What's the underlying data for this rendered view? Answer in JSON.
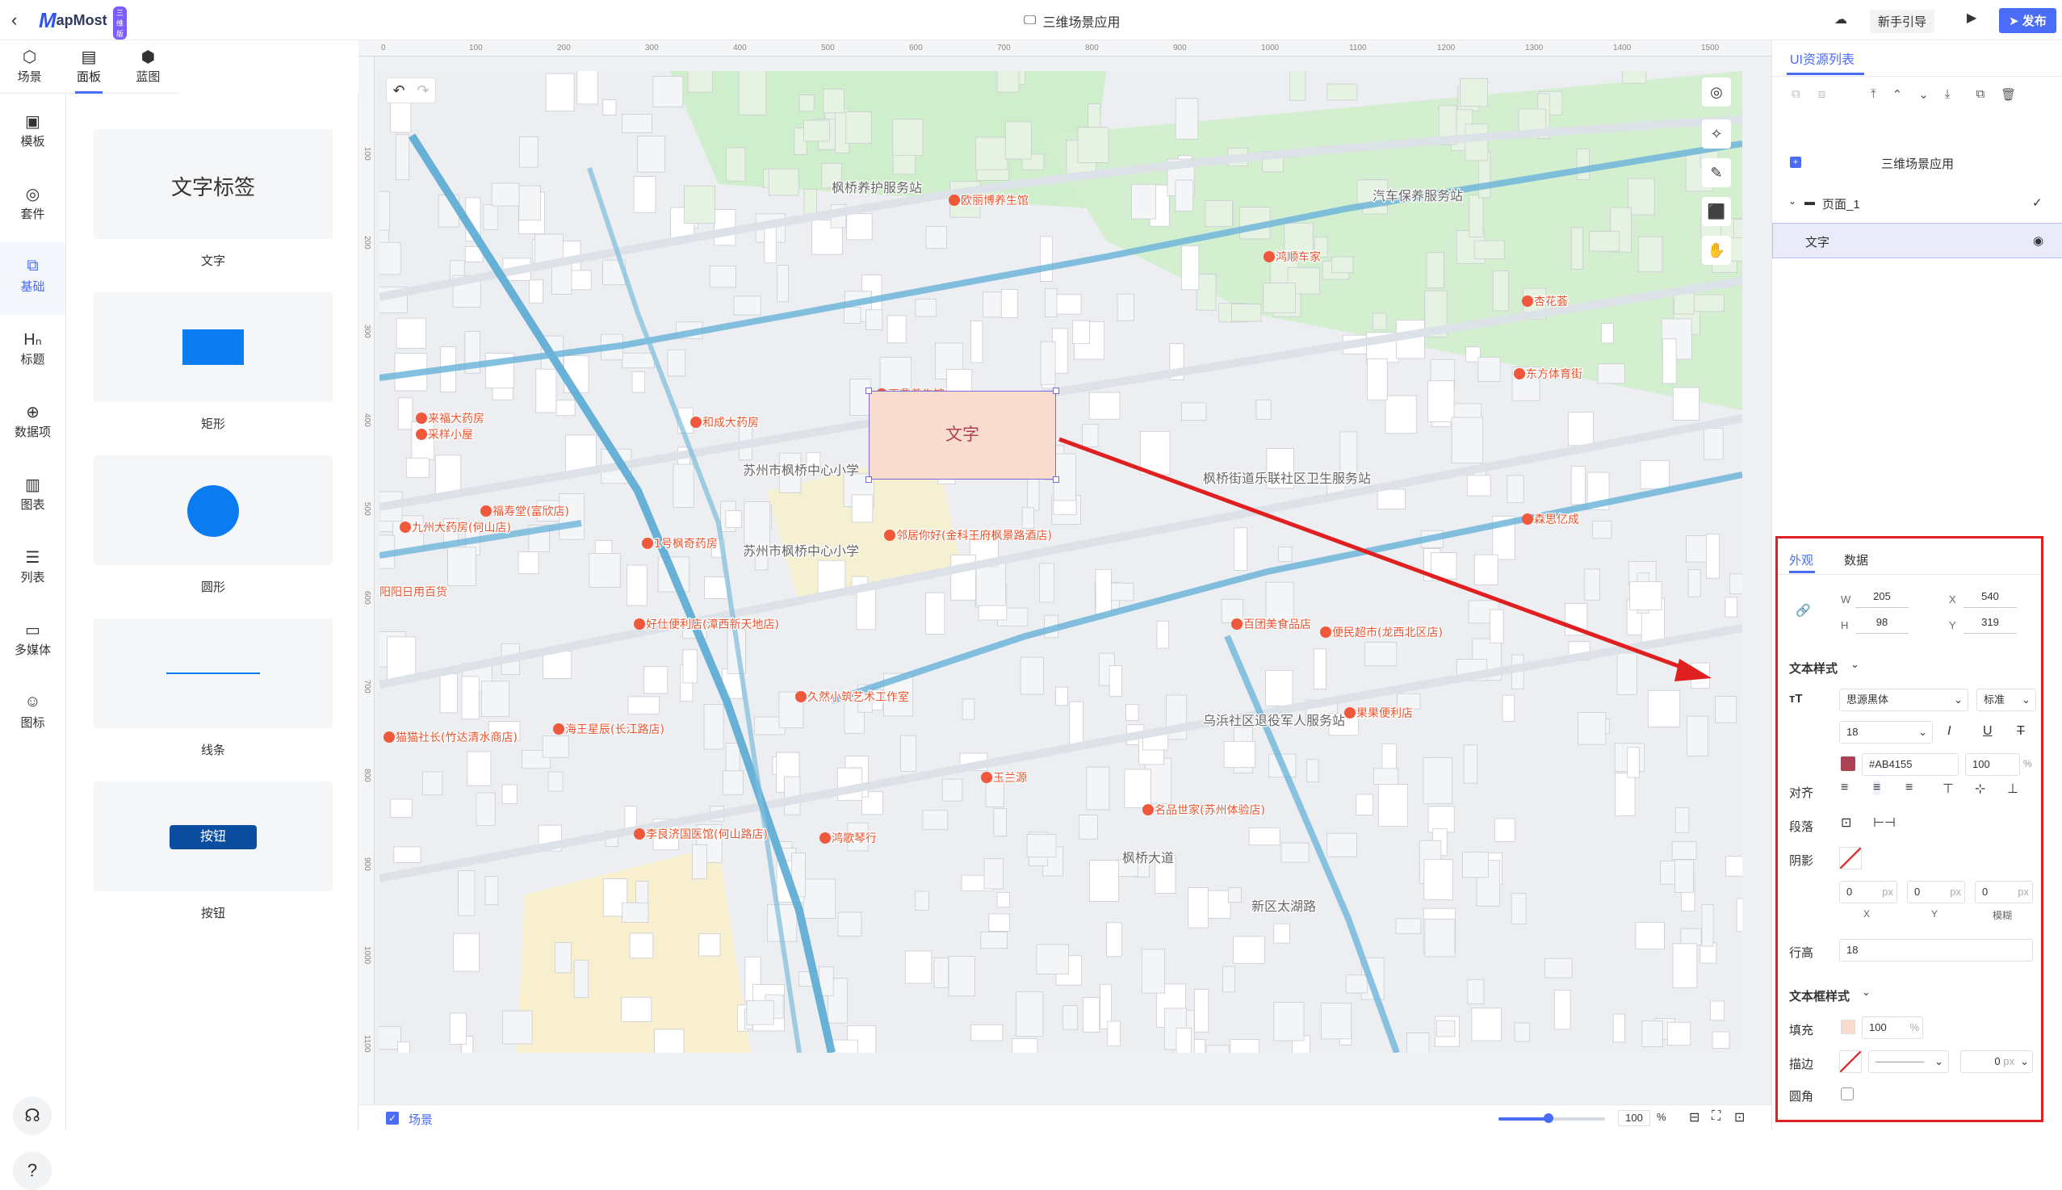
{
  "header": {
    "logo_text": "apMost",
    "logo_badge": "三维版",
    "app_title": "三维场景应用",
    "guide_label": "新手引导",
    "publish_label": "发布"
  },
  "left_tabs": [
    {
      "label": "场景",
      "icon": "scene-icon"
    },
    {
      "label": "面板",
      "icon": "panel-icon"
    },
    {
      "label": "蓝图",
      "icon": "blueprint-icon"
    }
  ],
  "left_nav": [
    {
      "label": "模板"
    },
    {
      "label": "套件"
    },
    {
      "label": "基础"
    },
    {
      "label": "标题"
    },
    {
      "label": "数据项"
    },
    {
      "label": "图表"
    },
    {
      "label": "列表"
    },
    {
      "label": "多媒体"
    },
    {
      "label": "图标"
    }
  ],
  "palette": [
    {
      "label": "文字",
      "preview": "文字标签"
    },
    {
      "label": "矩形"
    },
    {
      "label": "圆形"
    },
    {
      "label": "线条"
    },
    {
      "label": "按钮",
      "preview": "按钮"
    }
  ],
  "ruler": {
    "h": [
      "0",
      "100",
      "200",
      "300",
      "400",
      "500",
      "600",
      "700",
      "800",
      "900",
      "1000",
      "1100",
      "1200",
      "1300",
      "1400",
      "1500"
    ],
    "v": [
      "100",
      "200",
      "300",
      "400",
      "500",
      "600",
      "700",
      "800",
      "900",
      "1000",
      "1100"
    ]
  },
  "canvas": {
    "text_element": "文字",
    "labels": [
      "苏州市枫桥中心小学",
      "乌浜社区退役军人服务站",
      "久然小筑艺术工作室",
      "鸿歌琴行",
      "名品世家(苏州体验店)",
      "玉兰源",
      "李良济国医馆(何山路店)",
      "海王星辰(长江路店)",
      "好仕便利店(漳西新天地店)",
      "福寿堂(富欣店)",
      "邻居你好(金科王府枫景路酒店)",
      "百团美食品店",
      "便民超市(龙西北区店)",
      "果果便利店",
      "1号枫奇药房",
      "九州大药房(何山店)",
      "阳阳日用百货",
      "猫猫社长(竹达清水商店)",
      "来福大药房",
      "采样小屋",
      "和成大药房",
      "欧丽博养生馆",
      "枫桥街道乐联社区卫生服务站",
      "东方体育街",
      "鸿顺车家",
      "正鼎养生馆",
      "森思亿成",
      "苏州市枫桥中心小学",
      "枫桥养护服务站",
      "汽车保养服务站",
      "杏花荟",
      "新区太湖路",
      "枫桥大道"
    ]
  },
  "bottom": {
    "scene_label": "场景",
    "zoom": "100",
    "zoom_unit": "%"
  },
  "right": {
    "tab": "UI资源列表",
    "tree": {
      "root": "三维场景应用",
      "page": "页面_1",
      "item": "文字"
    },
    "prop_tabs": [
      "外观",
      "数据"
    ],
    "size": {
      "w_label": "W",
      "w": "205",
      "h_label": "H",
      "h": "98",
      "x_label": "X",
      "x": "540",
      "y_label": "Y",
      "y": "319"
    },
    "text_style_title": "文本样式",
    "font": "思源黑体",
    "weight": "标准",
    "font_size": "18",
    "color": "#AB4155",
    "opacity": "100",
    "percent": "%",
    "align_label": "对齐",
    "paragraph_label": "段落",
    "shadow_label": "阴影",
    "shadow": {
      "x": "0",
      "y": "0",
      "blur": "0",
      "unit": "px",
      "x_label": "X",
      "y_label": "Y",
      "blur_label": "模糊"
    },
    "line_height_label": "行高",
    "line_height": "18",
    "box_style_title": "文本框样式",
    "fill_label": "填充",
    "fill_opacity": "100",
    "stroke_label": "描边",
    "stroke_width": "0",
    "px": "px",
    "corner_label": "圆角"
  },
  "colors": {
    "accent": "#4a6cf7",
    "text_box_fill": "#f8dccd",
    "text_box_border": "#7b6bd8",
    "highlight_box": "#e02020",
    "arrow": "#e02020",
    "swatch_text": "#AB4155"
  }
}
